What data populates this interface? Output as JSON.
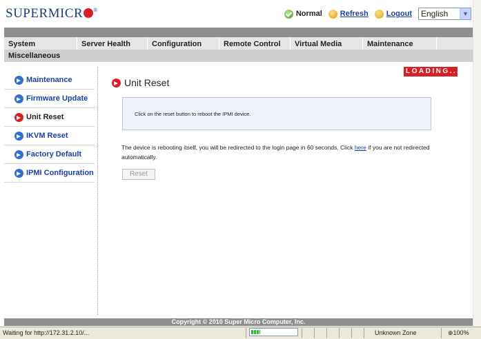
{
  "brand": {
    "logo_text": "SUPERMICR",
    "registered": "®"
  },
  "header": {
    "status": "Normal",
    "refresh": "Refresh",
    "logout": "Logout",
    "language": "English"
  },
  "nav": {
    "tabs": [
      "System",
      "Server Health",
      "Configuration",
      "Remote Control",
      "Virtual Media",
      "Maintenance"
    ],
    "second_row": "Miscellaneous"
  },
  "sidebar": {
    "items": [
      {
        "label": "Maintenance",
        "active": false
      },
      {
        "label": "Firmware Update",
        "active": false
      },
      {
        "label": "Unit Reset",
        "active": true
      },
      {
        "label": "IKVM Reset",
        "active": false
      },
      {
        "label": "Factory Default",
        "active": false
      },
      {
        "label": "IPMI Configuration",
        "active": false
      }
    ]
  },
  "main": {
    "loading": "LOADING...",
    "title": "Unit Reset",
    "info": "Click on the reset button to reboot the IPMI device.",
    "message_before": "The device is rebooting itself, you will be redirected to the login page in 60 seconds. Click ",
    "message_link": "here",
    "message_after": " if you are not redirected automatically.",
    "reset_button": "Reset"
  },
  "footer": {
    "copyright": "Copyright © 2010 Super Micro Computer, Inc."
  },
  "browser_status": {
    "text": "Waiting for http://172.31.2.10/...",
    "progress": 0.2,
    "zone": "Unknown Zone",
    "zoom": "100%"
  },
  "colors": {
    "brand_red": "#d71f26",
    "link_blue": "#1a3fa8",
    "nav_gray": "#8e8e8e"
  }
}
